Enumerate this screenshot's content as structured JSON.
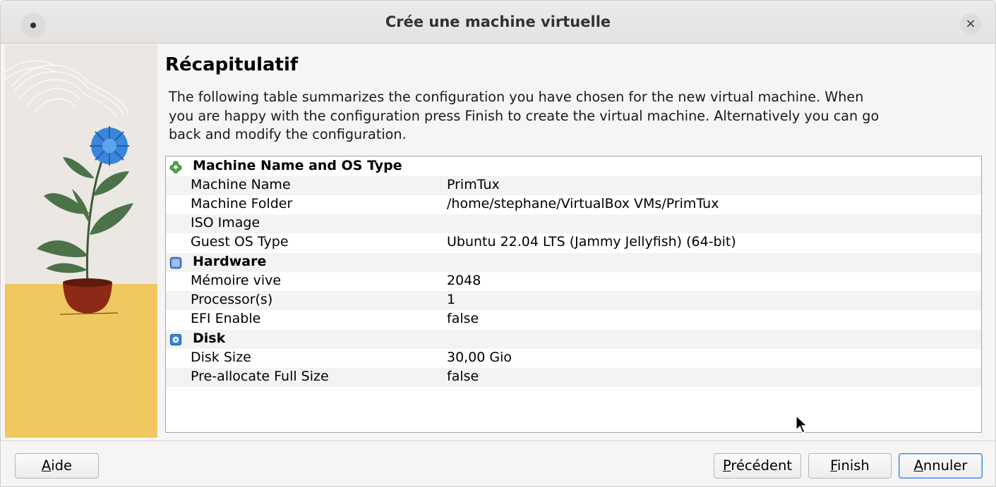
{
  "window": {
    "title": "Crée une machine virtuelle",
    "close_glyph": "×"
  },
  "page": {
    "heading": "Récapitulatif",
    "intro": "The following table summarizes the configuration you have chosen for the new virtual machine. When you are happy with the configuration press Finish to create the virtual machine. Alternatively you can go back and modify the configuration."
  },
  "summary": {
    "sections": [
      {
        "title": "Machine Name and OS Type",
        "icon": "puzzle-icon",
        "rows": [
          {
            "key": "Machine Name",
            "value": "PrimTux"
          },
          {
            "key": "Machine Folder",
            "value": "/home/stephane/VirtualBox VMs/PrimTux"
          },
          {
            "key": "ISO Image",
            "value": ""
          },
          {
            "key": "Guest OS Type",
            "value": "Ubuntu 22.04 LTS (Jammy Jellyfish) (64-bit)"
          }
        ]
      },
      {
        "title": "Hardware",
        "icon": "chip-icon",
        "rows": [
          {
            "key": "Mémoire vive",
            "value": "2048"
          },
          {
            "key": "Processor(s)",
            "value": "1"
          },
          {
            "key": "EFI Enable",
            "value": "false"
          }
        ]
      },
      {
        "title": "Disk",
        "icon": "disk-icon",
        "rows": [
          {
            "key": "Disk Size",
            "value": "30,00 Gio"
          },
          {
            "key": "Pre-allocate Full Size",
            "value": "false"
          }
        ]
      }
    ]
  },
  "buttons": {
    "help": {
      "mnemonic": "A",
      "rest": "ide"
    },
    "back": {
      "mnemonic": "P",
      "rest": "récédent"
    },
    "finish": {
      "mnemonic": "F",
      "rest": "inish"
    },
    "cancel": {
      "mnemonic": "A",
      "rest": "nnuler"
    }
  },
  "colors": {
    "accent": "#3584e4",
    "flower": "#3a86d8",
    "pot": "#8b2a17",
    "sand": "#f0c860"
  }
}
